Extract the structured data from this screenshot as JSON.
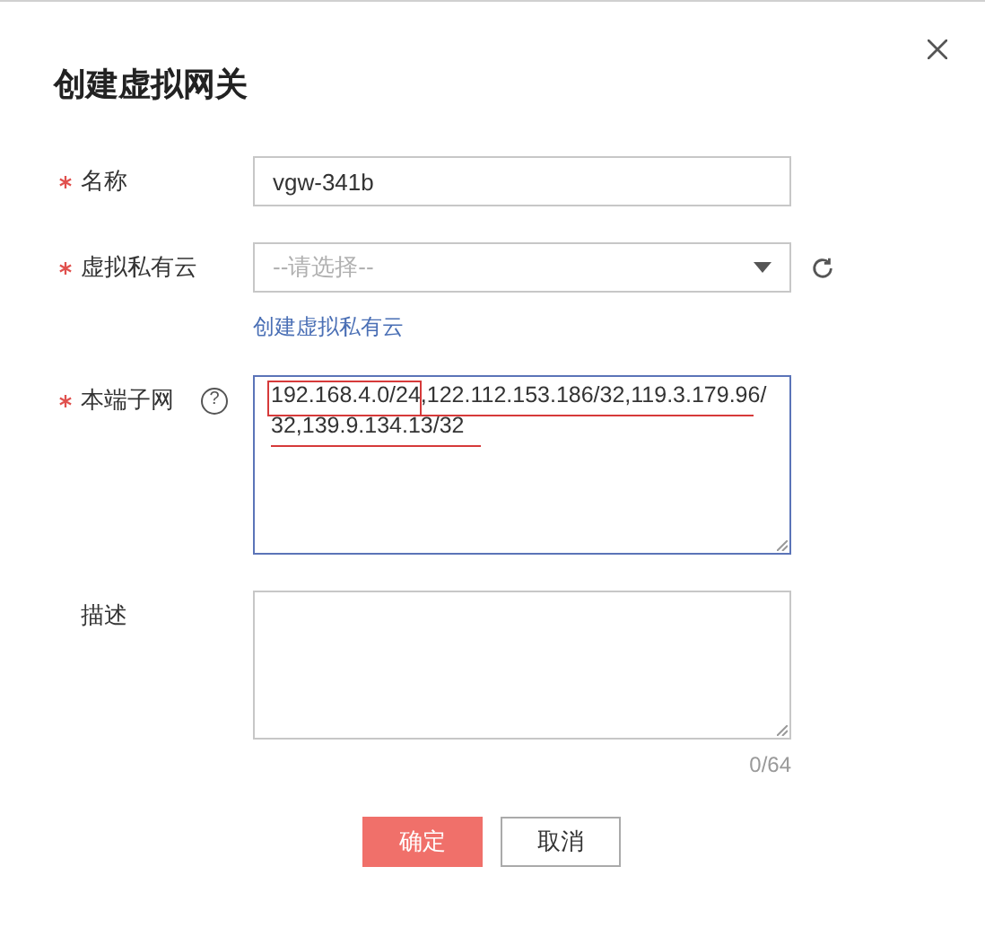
{
  "dialog": {
    "title": "创建虚拟网关"
  },
  "fields": [
    {
      "kind": "input",
      "label": "名称",
      "required": true,
      "value": "vgw-341b"
    },
    {
      "kind": "select",
      "label": "虚拟私有云",
      "required": true,
      "placeholder": "--请选择--",
      "link": "创建虚拟私有云"
    },
    {
      "kind": "textarea",
      "label": "本端子网",
      "required": true,
      "help": "?",
      "value": "192.168.4.0/24,122.112.153.186/32,119.3.179.96/32,139.9.134.13/32",
      "focused": true
    },
    {
      "kind": "textarea",
      "label": "描述",
      "required": false,
      "counter": "0/64",
      "focused": false
    }
  ],
  "buttons": [
    {
      "label": "确定",
      "primary": true
    },
    {
      "label": "取消",
      "primary": false
    }
  ]
}
